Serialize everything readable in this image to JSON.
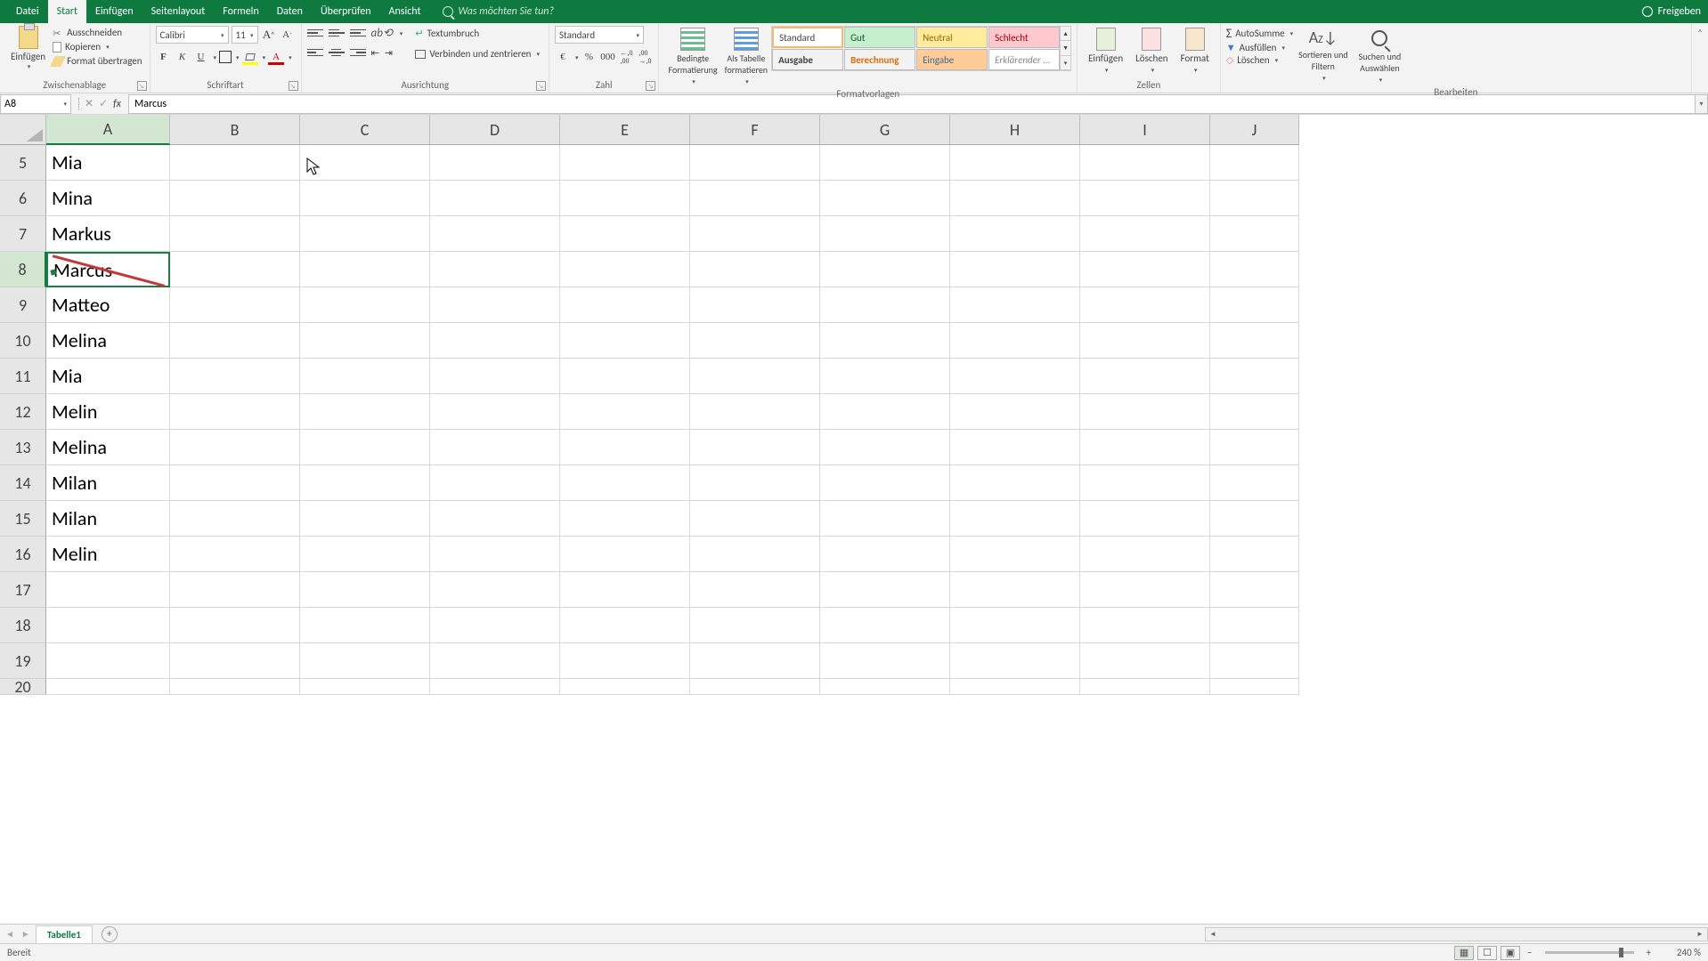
{
  "tabs": {
    "datei": "Datei",
    "start": "Start",
    "einfuegen": "Einfügen",
    "seitenlayout": "Seitenlayout",
    "formeln": "Formeln",
    "daten": "Daten",
    "ueberpruefen": "Überprüfen",
    "ansicht": "Ansicht"
  },
  "tellme": "Was möchten Sie tun?",
  "share": "Freigeben",
  "clipboard": {
    "paste": "Einfügen",
    "cut": "Ausschneiden",
    "copy": "Kopieren",
    "format_painter": "Format übertragen",
    "group": "Zwischenablage"
  },
  "font": {
    "name": "Calibri",
    "size": "11",
    "group": "Schriftart"
  },
  "alignment": {
    "wrap": "Textumbruch",
    "merge": "Verbinden und zentrieren",
    "group": "Ausrichtung"
  },
  "number": {
    "format": "Standard",
    "group": "Zahl"
  },
  "styles": {
    "cond_format": "Bedingte\nFormatierung",
    "as_table": "Als Tabelle\nformatieren",
    "style_standard": "Standard",
    "style_gut": "Gut",
    "style_neutral": "Neutral",
    "style_schlecht": "Schlecht",
    "style_ausgabe": "Ausgabe",
    "style_berechnung": "Berechnung",
    "style_eingabe": "Eingabe",
    "style_erkl": "Erklärender ...",
    "group": "Formatvorlagen"
  },
  "cells": {
    "insert": "Einfügen",
    "delete": "Löschen",
    "format": "Format",
    "group": "Zellen"
  },
  "editing": {
    "autosum": "AutoSumme",
    "fill": "Ausfüllen",
    "clear": "Löschen",
    "sort": "Sortieren und\nFiltern",
    "find": "Suchen und\nAuswählen",
    "group": "Bearbeiten"
  },
  "namebox": "A8",
  "formula": "Marcus",
  "columns": [
    "A",
    "B",
    "C",
    "D",
    "E",
    "F",
    "G",
    "H",
    "I",
    "J"
  ],
  "rows": [
    {
      "n": "5",
      "a": "Mia"
    },
    {
      "n": "6",
      "a": "Mina"
    },
    {
      "n": "7",
      "a": "Markus"
    },
    {
      "n": "8",
      "a": "Marcus"
    },
    {
      "n": "9",
      "a": "Matteo"
    },
    {
      "n": "10",
      "a": "Melina"
    },
    {
      "n": "11",
      "a": "Mia"
    },
    {
      "n": "12",
      "a": "Melin"
    },
    {
      "n": "13",
      "a": "Melina"
    },
    {
      "n": "14",
      "a": "Milan"
    },
    {
      "n": "15",
      "a": "Milan"
    },
    {
      "n": "16",
      "a": "Melin"
    },
    {
      "n": "17",
      "a": ""
    },
    {
      "n": "18",
      "a": ""
    },
    {
      "n": "19",
      "a": ""
    },
    {
      "n": "20",
      "a": ""
    }
  ],
  "sheet_tab": "Tabelle1",
  "status": "Bereit",
  "zoom": "240 %"
}
